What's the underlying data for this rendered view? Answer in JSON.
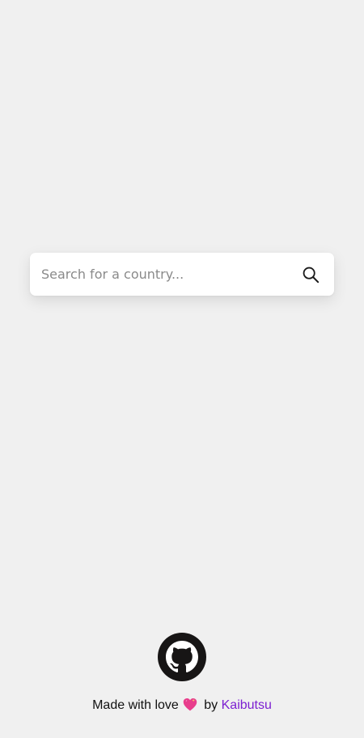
{
  "search": {
    "placeholder": "Search for a country...",
    "value": "",
    "button_icon": "search-icon"
  },
  "footer": {
    "github_icon": "github-icon",
    "made_with": "Made with love",
    "heart_icon": "heart-icon",
    "by": "by",
    "author": "Kaibutsu"
  },
  "colors": {
    "background": "#f0f0f0",
    "author_link": "#7c1fd1",
    "github_circle": "#171515",
    "heart": "#e83e8c"
  }
}
